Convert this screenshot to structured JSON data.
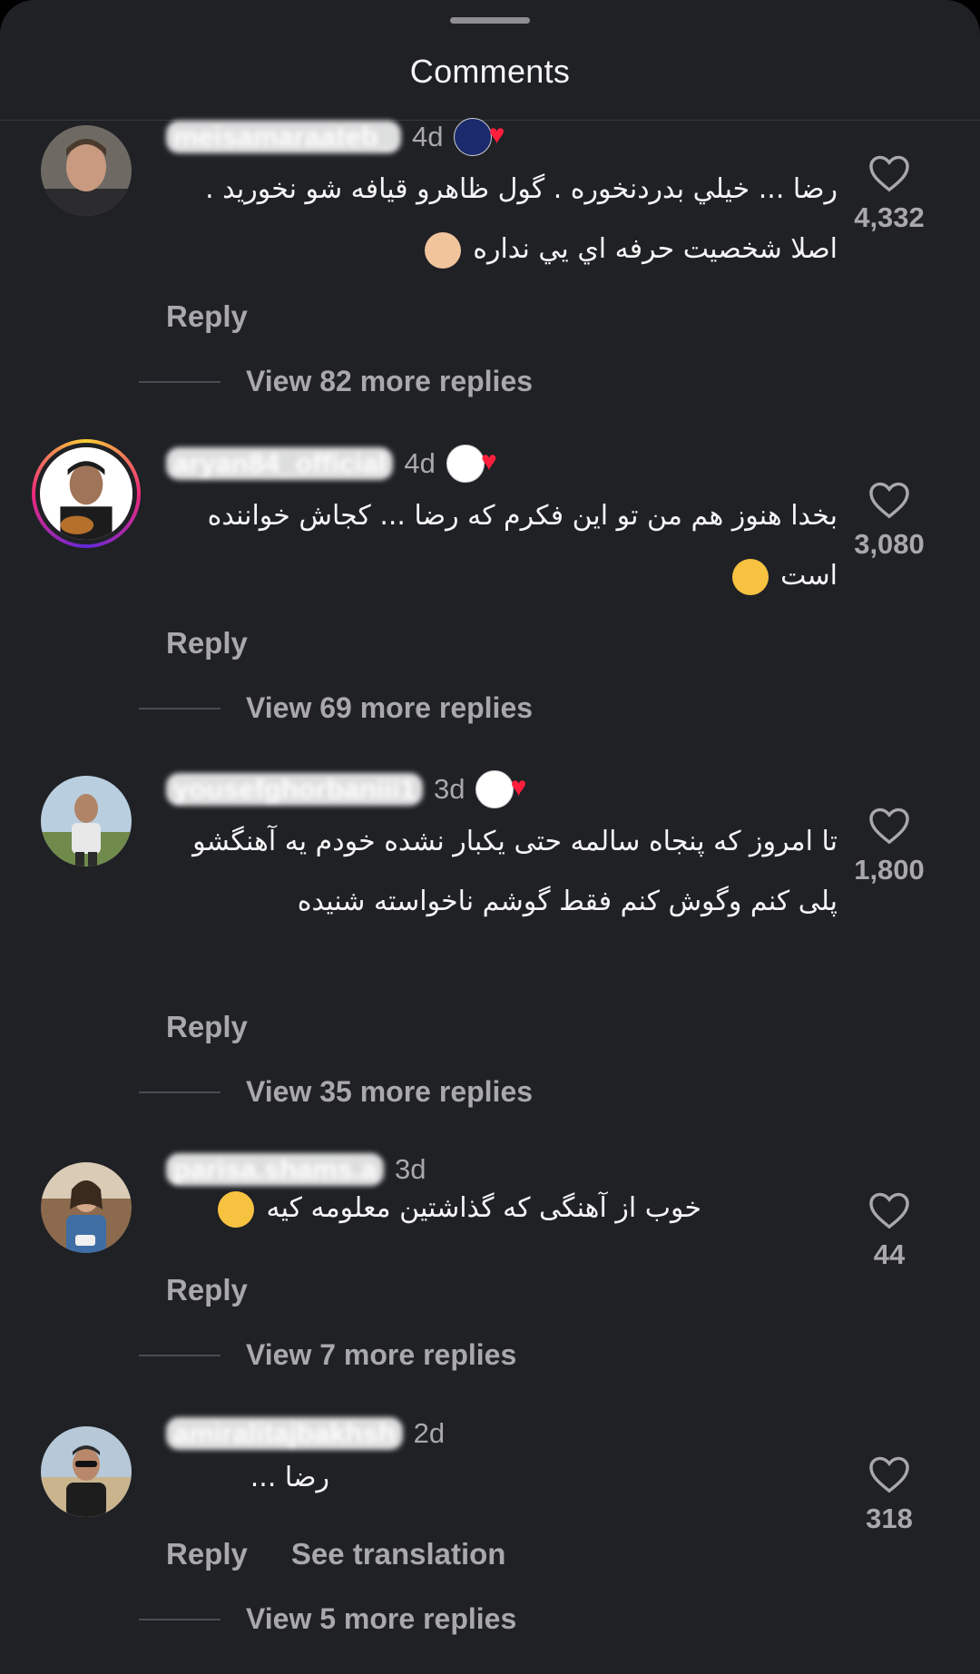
{
  "header": {
    "title": "Comments"
  },
  "labels": {
    "reply": "Reply",
    "see_translation": "See translation"
  },
  "colors": {
    "background": "#1f2125",
    "text": "#f5f5f5",
    "muted": "#a8a8ad",
    "heart_badge": "#ff1f3d"
  },
  "comments": [
    {
      "username": "meisamaraateb_",
      "time": "4d",
      "text": "رضا ... خيلي بدردنخوره . گول ظاهرو قيافه شو نخوريد . اصلا شخصيت حرفه اي يي نداره",
      "emoji": "ok-hand",
      "likes": "4,332",
      "view_replies": "View 82 more replies",
      "badge": "creator-badge"
    },
    {
      "username": "aryan84_official",
      "time": "4d",
      "text": "بخدا هنوز هم من تو اين فكرم كه رضا ... كجاش خواننده است",
      "emoji": "thinking-face",
      "likes": "3,080",
      "view_replies": "View 69 more replies",
      "badge": "creator-badge"
    },
    {
      "username": "yousefghorbaniii1",
      "time": "3d",
      "text": "تا امروز که پنجاه سالمه حتی یکبار نشده خودم یه آهنگشو پلی کنم وگوش کنم فقط گوشم ناخواسته شنیده",
      "emoji": "",
      "likes": "1,800",
      "view_replies": "View 35 more replies",
      "badge": "creator-badge"
    },
    {
      "username": "parisa.shams.a",
      "time": "3d",
      "text": "خوب از آهنگی که گذاشتین معلومه کیه",
      "emoji": "tears-of-joy",
      "likes": "44",
      "view_replies": "View 7 more replies",
      "badge": ""
    },
    {
      "username": "amiralitajbakhsh",
      "time": "2d",
      "text": "رضا ...",
      "emoji": "",
      "likes": "318",
      "view_replies": "View 5 more replies",
      "badge": ""
    }
  ]
}
